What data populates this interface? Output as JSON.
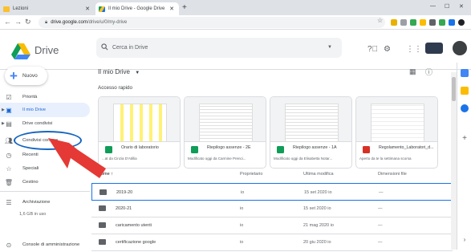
{
  "browser": {
    "tabs": [
      {
        "label": "Lezioni",
        "color": "#fbc02d"
      },
      {
        "label": "Il mio Drive - Google Drive",
        "color": "#1a73e8"
      }
    ],
    "url_host": "drive.google.com",
    "url_path": "/drive/u/0/my-drive"
  },
  "app": {
    "brand": "Drive",
    "search_placeholder": "Cerca in Drive",
    "new_button": "Nuovo",
    "title": "Il mio Drive",
    "quick_access": "Accesso rapido"
  },
  "sidebar": {
    "items": [
      {
        "label": "Priorità",
        "icon": "check-icon"
      },
      {
        "label": "Il mio Drive",
        "icon": "drive-icon"
      },
      {
        "label": "Drive condivisi",
        "icon": "shared-drive-icon"
      },
      {
        "label": "Condivisi con me",
        "icon": "people-icon"
      },
      {
        "label": "Recenti",
        "icon": "clock-icon"
      },
      {
        "label": "Speciali",
        "icon": "star-icon"
      },
      {
        "label": "Cestino",
        "icon": "trash-icon"
      }
    ],
    "storage_label": "Archiviazione",
    "storage_value": "1,6 GB in uso",
    "admin": "Console di amministrazione"
  },
  "cards": [
    {
      "name": "Orario di laboratorio",
      "sub": "...at da Cinzia D'Atillia",
      "color": "#0f9d58"
    },
    {
      "name": "Riepilogo assenze - 2E",
      "sub": "Modificato oggi da Carmine Prenci...",
      "color": "#0f9d58"
    },
    {
      "name": "Riepilogo assenze - 1A",
      "sub": "Modificato oggi da Elisabetta Notar...",
      "color": "#0f9d58"
    },
    {
      "name": "Regolamento_Laboratori_d...",
      "sub": "Aperto da te la settimana scorsa",
      "color": "#d93025"
    }
  ],
  "table": {
    "headers": {
      "name": "Nome",
      "owner": "Proprietario",
      "modified": "Ultima modifica",
      "size": "Dimensioni file"
    },
    "rows": [
      {
        "name": "2019-20",
        "owner": "io",
        "modified": "15 set 2020 io",
        "size": "—"
      },
      {
        "name": "2020-21",
        "owner": "io",
        "modified": "15 set 2020 io",
        "size": "—"
      },
      {
        "name": "caricamento utenti",
        "owner": "io",
        "modified": "21 mag 2020 io",
        "size": "—"
      },
      {
        "name": "certificazione google",
        "owner": "io",
        "modified": "20 giu 2020 io",
        "size": "—"
      }
    ]
  },
  "colors": {
    "accent": "#1a73e8",
    "annotation_circle": "#1565c0",
    "annotation_arrow": "#e53935"
  }
}
